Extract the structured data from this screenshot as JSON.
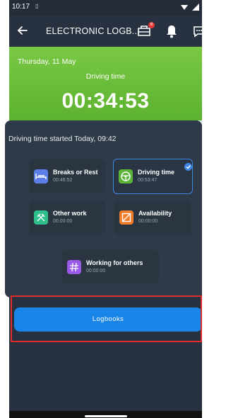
{
  "status_bar": {
    "time": "10:17",
    "sim_icon": "sim-card-icon",
    "right_icons": [
      "wifi-icon",
      "signal-icon"
    ]
  },
  "app_bar": {
    "title": "ELECTRONIC LOGB...",
    "back_icon": "back-arrow-icon",
    "actions": [
      {
        "icon": "truck-icon",
        "badge": "6"
      },
      {
        "icon": "bell-icon"
      },
      {
        "icon": "chat-icon"
      }
    ]
  },
  "hero": {
    "date": "Thursday, 11 May",
    "label": "Driving time",
    "timer": "00:34:53",
    "color": "#6abd3a"
  },
  "activities": {
    "heading": "Driving time started Today, 09:42",
    "tiles": [
      {
        "title": "Breaks or Rest",
        "time": "00:46:52",
        "color": "#5b7ee8",
        "icon": "bed-icon",
        "active": false
      },
      {
        "title": "Driving time",
        "time": "00:53:47",
        "color": "#5cb43a",
        "icon": "steering-wheel-icon",
        "active": true
      },
      {
        "title": "Other work",
        "time": "00:00:00",
        "color": "#2fbf8c",
        "icon": "hammers-icon",
        "active": false
      },
      {
        "title": "Availability",
        "time": "00:00:00",
        "color": "#f07d2a",
        "icon": "availability-icon",
        "active": false
      },
      {
        "title": "Working for others",
        "time": "00:00:00",
        "color": "#9a5ae8",
        "icon": "hash-icon",
        "active": false
      }
    ]
  },
  "logbooks_button": {
    "label": "Logbooks",
    "color": "#1a85e8"
  },
  "highlight_color": "#e02b2b"
}
